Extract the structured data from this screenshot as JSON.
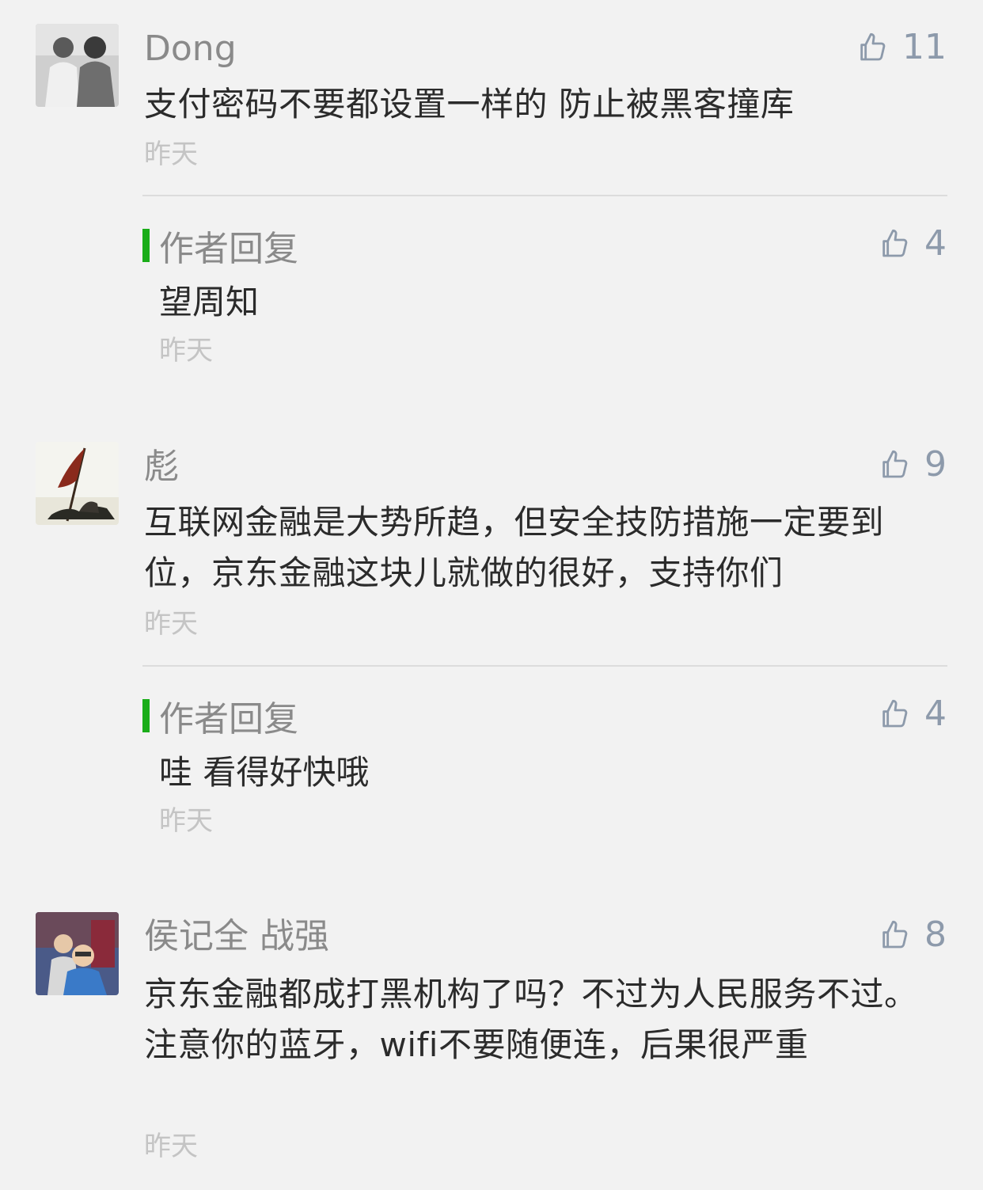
{
  "comments": [
    {
      "name": "Dong",
      "content": "支付密码不要都设置一样的 防止被黑客撞库",
      "time": "昨天",
      "likes": "11",
      "avatar_icon": "user-photo",
      "reply": {
        "label": "作者回复",
        "content": "望周知",
        "time": "昨天",
        "likes": "4"
      }
    },
    {
      "name": "彪",
      "content": "互联网金融是大势所趋，但安全技防措施一定要到位，京东金融这块儿就做的很好，支持你们",
      "time": "昨天",
      "likes": "9",
      "avatar_icon": "flag-photo",
      "reply": {
        "label": "作者回复",
        "content": "哇 看得好快哦",
        "time": "昨天",
        "likes": "4"
      }
    },
    {
      "name": "侯记全 战强",
      "content": "京东金融都成打黑机构了吗？不过为人民服务不过。注意你的蓝牙，wifi不要随便连，后果很严重",
      "time": "昨天",
      "likes": "8",
      "avatar_icon": "user-photo"
    }
  ],
  "colors": {
    "accent_green": "#1aad19",
    "like_blue_gray": "#8d9aab",
    "name_gray": "#8a8a8a",
    "time_gray": "#c4c4c4"
  }
}
